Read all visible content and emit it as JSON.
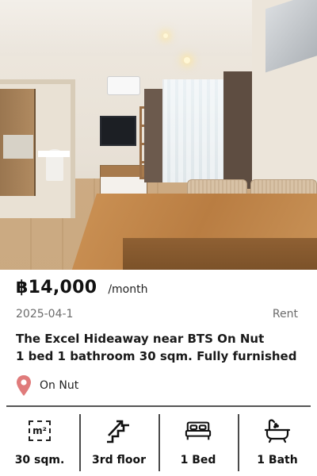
{
  "listing": {
    "photo_alt": "",
    "price": "฿14,000",
    "price_unit": "/month",
    "date": "2025-04-1",
    "type": "Rent",
    "title_line1": "The Excel Hideaway near BTS On Nut",
    "title_line2": "1 bed 1 bathroom 30 sqm. Fully furnished",
    "location": "On Nut",
    "pin_color": "#e07b7b"
  },
  "features": [
    {
      "icon": "area-sqm-icon",
      "icon_text": "m²",
      "label": "30 sqm."
    },
    {
      "icon": "stairs-icon",
      "label": "3rd floor"
    },
    {
      "icon": "bed-icon",
      "label": "1 Bed"
    },
    {
      "icon": "bathtub-icon",
      "label": "1 Bath"
    }
  ]
}
